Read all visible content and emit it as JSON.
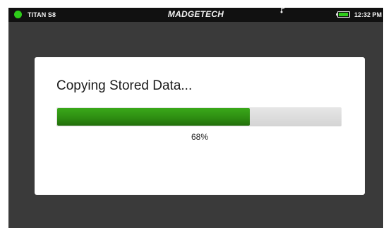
{
  "status_bar": {
    "device_name": "TITAN S8",
    "brand": "MADGETECH",
    "time": "12:32 PM",
    "status_color": "#2ecc1a",
    "battery_color": "#2ecc1a",
    "icons": [
      "status-dot-icon",
      "usb-icon",
      "battery-icon"
    ]
  },
  "dialog": {
    "title": "Copying Stored Data...",
    "progress_percent": 68,
    "progress_label": "68%",
    "progress_color": "#2e8e12"
  }
}
